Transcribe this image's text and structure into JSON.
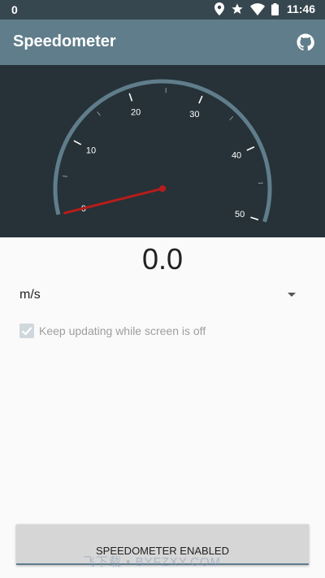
{
  "status_bar": {
    "left_text": "0",
    "time": "11:46",
    "icons": [
      "location-icon",
      "star-icon",
      "wifi-icon",
      "battery-icon"
    ]
  },
  "app_bar": {
    "title": "Speedometer",
    "action_icon": "github-icon"
  },
  "gauge": {
    "min": 0,
    "max": 50,
    "labels": [
      "0",
      "10",
      "20",
      "30",
      "40",
      "50"
    ],
    "needle_value": 0
  },
  "speed": {
    "value": "0.0"
  },
  "unit_select": {
    "selected": "m/s"
  },
  "keep_updating": {
    "label": "Keep updating while screen is off",
    "checked": true
  },
  "enable_button": {
    "label": "SPEEDOMETER ENABLED"
  },
  "watermark": {
    "text": "飞下载 • BYFZXY.COM"
  },
  "colors": {
    "status_bar": "#37474f",
    "app_bar": "#607d8b",
    "gauge_bg": "#263238",
    "gauge_arc": "#607d8b",
    "needle": "#b71c1c"
  }
}
